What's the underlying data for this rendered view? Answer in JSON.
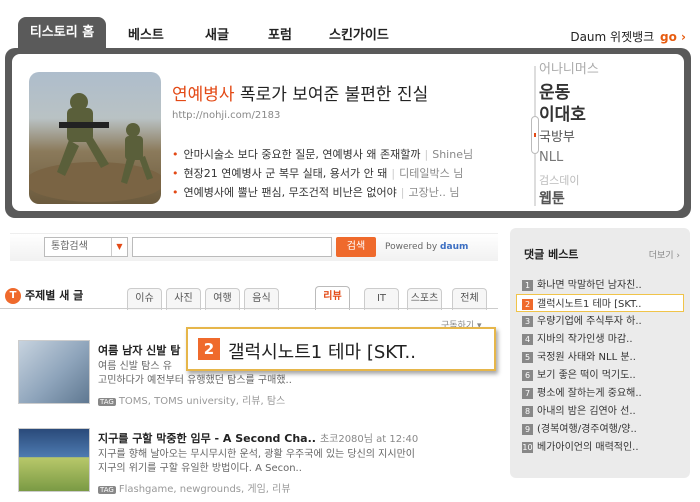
{
  "topnav": {
    "tabs": [
      "티스토리 홈",
      "베스트",
      "새글",
      "포럼",
      "스킨가이드"
    ],
    "brand_link": "Daum 위젯뱅크",
    "brand_go": "go ›"
  },
  "hero": {
    "title_highlight": "연예병사",
    "title_rest": " 폭로가 보여준 불편한 진실",
    "url": "http://nohji.com/2183",
    "items": [
      {
        "text": "안마시술소 보다 중요한 질문, 연예병사 왜 존재할까",
        "author": "Shine님"
      },
      {
        "text": "현장21 연예병사 군 복무 실태, 용서가 안 돼",
        "author": "디테일박스 님"
      },
      {
        "text": "연예병사에 뿔난 팬심, 무조건적 비난은 없어야",
        "author": "고장난.. 님"
      }
    ],
    "keywords": [
      "어나니머스",
      "운동",
      "이대호",
      "국방부",
      "NLL",
      "검스데이",
      "웹툰"
    ]
  },
  "search": {
    "select_value": "통합검색",
    "button": "검색",
    "powered_by": "Powered by",
    "powered_brand": "daum"
  },
  "topics": {
    "title": "주제별 새 글",
    "tabs": [
      "이슈",
      "사진",
      "여행",
      "음식",
      "리뷰",
      "IT",
      "스포츠",
      "전체"
    ],
    "subscribe": "구독하기 ▾"
  },
  "posts": [
    {
      "title": "여름 남자 신발 탐",
      "meta": "",
      "desc": "여름 신발 탐스 유",
      "desc2": "고민하다가 예전부터 유행했던 탐스를 구매했..",
      "tags": "TOMS, TOMS university, 리뷰, 탐스"
    },
    {
      "title": "지구를 구할 막중한 임무 - A Second Cha..",
      "meta": "초코2080님 at 12:40",
      "desc": "지구를 향해 날아오는 무시무시한 운석, 광활 우주국에 있는 당신의 지시만이",
      "desc2": "지구의 위기를 구할 유일한 방법이다. A Secon..",
      "tags": "Flashgame, newgrounds, 게임, 리뷰"
    }
  ],
  "sidebar": {
    "title": "댓글 베스트",
    "more": "더보기 ›",
    "items": [
      "화나면 막말하던 남자친..",
      "갤럭시노트1 테마 [SKT..",
      "우량기업에 주식투자 하..",
      "지바의 작가인생 마감..",
      "국정원 사태와 NLL 분..",
      "보기 좋은 떡이 먹기도..",
      "평소에 잘하는게 중요해..",
      "아내의 밤은 김연아 선..",
      "(경복여행/경주여행/양..",
      "베가아이언의 매력적인.."
    ],
    "selected_index": 1
  },
  "tooltip": {
    "number": "2",
    "text": "갤럭시노트1 테마 [SKT.."
  },
  "colors": {
    "accent": "#ef6a2c",
    "dark_frame": "#5a5a5a",
    "highlight_border": "#e6b64a"
  }
}
